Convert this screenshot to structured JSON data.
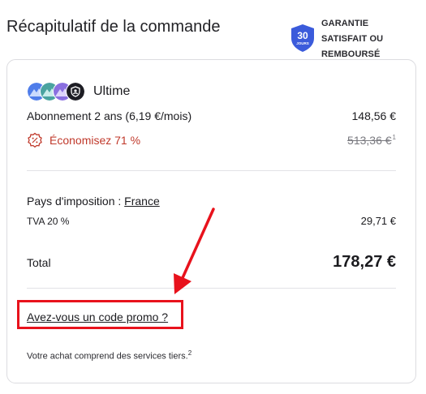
{
  "header": {
    "title": "Récapitulatif de la commande"
  },
  "guarantee": {
    "badge_number": "30",
    "badge_unit": "JOURS",
    "line1": "GARANTIE",
    "line2": "SATISFAIT OU",
    "line3": "REMBOURSÉ",
    "color": "#3b5bdb"
  },
  "plan": {
    "name": "Ultime",
    "icons": [
      "vpn-mountain-icon",
      "mail-mountain-icon",
      "drive-mountain-icon",
      "pass-shield-icon"
    ]
  },
  "subscription": {
    "label": "Abonnement 2 ans (6,19 €/mois)",
    "price": "148,56 €"
  },
  "savings": {
    "label": "Économisez 71 %",
    "original_price": "513,36 €",
    "footnote": "1",
    "color": "#c0392b"
  },
  "tax": {
    "country_label": "Pays d'imposition :",
    "country": "France",
    "vat_label": "TVA 20 %",
    "vat_amount": "29,71 €"
  },
  "total": {
    "label": "Total",
    "amount": "178,27 €"
  },
  "promo": {
    "link": "Avez-vous un code promo ?",
    "highlight_color": "#e8121c"
  },
  "footer": {
    "note": "Votre achat comprend des services tiers.",
    "footnote": "2"
  }
}
